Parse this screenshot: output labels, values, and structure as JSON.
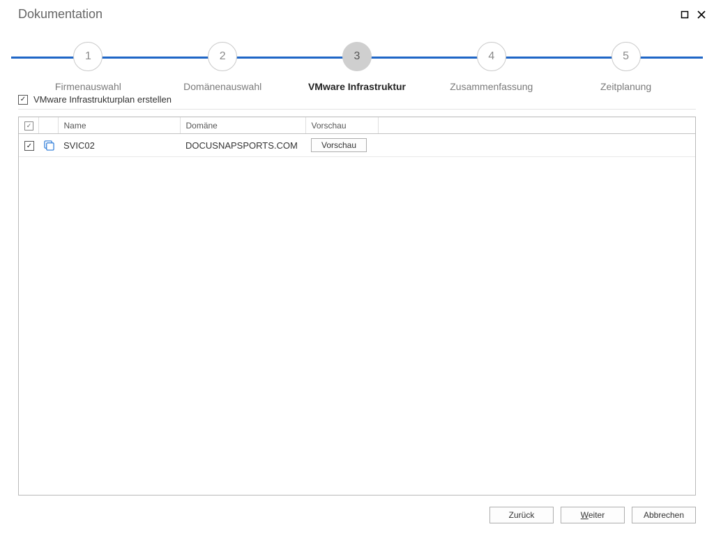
{
  "window": {
    "title": "Dokumentation"
  },
  "wizard": {
    "steps": [
      {
        "num": "1",
        "label": "Firmenauswahl",
        "active": false
      },
      {
        "num": "2",
        "label": "Domänenauswahl",
        "active": false
      },
      {
        "num": "3",
        "label": "VMware Infrastruktur",
        "active": true
      },
      {
        "num": "4",
        "label": "Zusammenfassung",
        "active": false
      },
      {
        "num": "5",
        "label": "Zeitplanung",
        "active": false
      }
    ]
  },
  "option": {
    "label": "VMware Infrastrukturplan erstellen",
    "checked": true
  },
  "table": {
    "columns": {
      "name": "Name",
      "domain": "Domäne",
      "preview": "Vorschau"
    },
    "rows": [
      {
        "checked": true,
        "name": "SVIC02",
        "domain": "DOCUSNAPSPORTS.COM",
        "preview_button": "Vorschau"
      }
    ]
  },
  "buttons": {
    "back": "Zurück",
    "next_prefix": "W",
    "next_rest": "eiter",
    "cancel": "Abbrechen"
  }
}
